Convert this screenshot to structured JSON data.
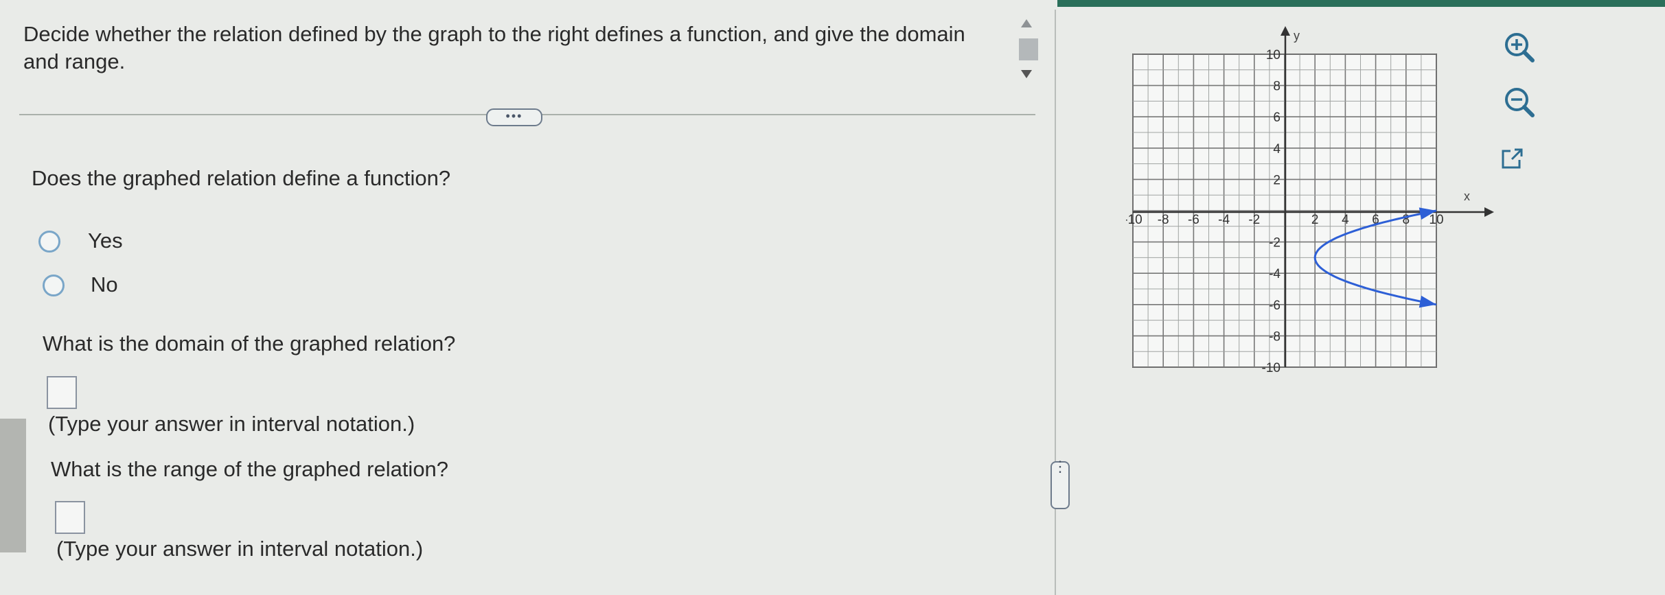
{
  "question": {
    "prompt": "Decide whether the relation defined by the graph to the right defines a function, and give the domain and range.",
    "more_label": "•••"
  },
  "part1": {
    "question": "Does the graphed relation define a function?",
    "options": [
      {
        "label": "Yes",
        "selected": false
      },
      {
        "label": "No",
        "selected": false
      }
    ]
  },
  "part2": {
    "question": "What is the domain of the graphed relation?",
    "hint": "(Type your answer in interval notation.)",
    "answer": ""
  },
  "part3": {
    "question": "What is the range of the graphed relation?",
    "hint": "(Type your answer in interval notation.)",
    "answer": ""
  },
  "splitter_label": "⋮",
  "graph": {
    "x_label": "x",
    "y_label": "y",
    "x_range": [
      -10,
      10
    ],
    "y_range": [
      -10,
      10
    ],
    "x_ticks": [
      "-10",
      "-8",
      "-6",
      "-4",
      "-2",
      "2",
      "4",
      "6",
      "8",
      "10"
    ],
    "y_ticks": [
      "10",
      "8",
      "6",
      "4",
      "2",
      "-2",
      "-4",
      "-6",
      "-8",
      "-10"
    ],
    "curve": {
      "type": "sideways parabola",
      "vertex": [
        2,
        -3
      ],
      "upper_end": [
        10,
        0
      ],
      "lower_end": [
        10,
        -6
      ],
      "color": "#2d5fd6"
    }
  },
  "toolbar": {
    "zoom_in": "zoom-in-icon",
    "zoom_out": "zoom-out-icon",
    "popout": "external-link-icon"
  },
  "colors": {
    "accent": "#2a6f5a",
    "radio": "#7aa6c8",
    "icon": "#2d6e92"
  }
}
